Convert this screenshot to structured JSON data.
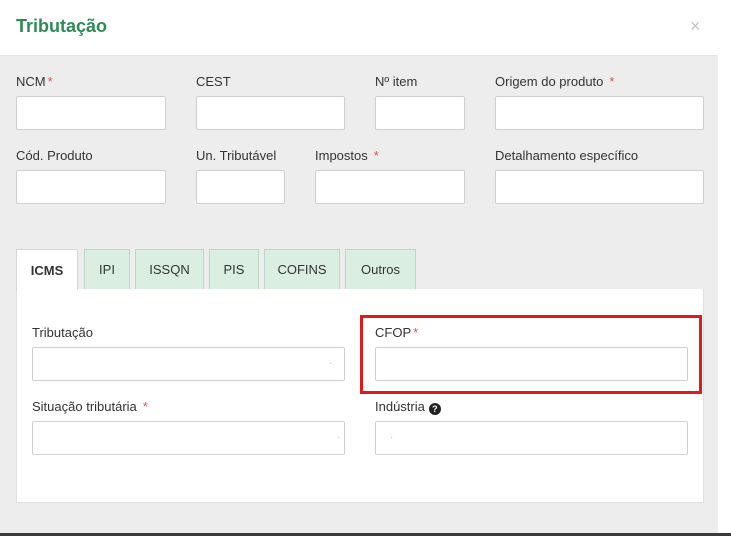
{
  "modal": {
    "title": "Tributação",
    "close_label": "×"
  },
  "fields": {
    "ncm": {
      "label": "NCM",
      "required": "*",
      "value": ""
    },
    "cest": {
      "label": "CEST",
      "value": ""
    },
    "n_item": {
      "label": "Nº item",
      "value": ""
    },
    "origem": {
      "label": "Origem do produto",
      "required": "*",
      "value": ""
    },
    "cod_produto": {
      "label": "Cód. Produto",
      "value": ""
    },
    "un_tributavel": {
      "label": "Un. Tributável",
      "value": ""
    },
    "impostos": {
      "label": "Impostos",
      "required": "*",
      "value": ""
    },
    "detalhamento": {
      "label": "Detalhamento específico",
      "value": ""
    }
  },
  "tabs": [
    {
      "label": "ICMS",
      "active": true
    },
    {
      "label": "IPI"
    },
    {
      "label": "ISSQN"
    },
    {
      "label": "PIS"
    },
    {
      "label": "COFINS"
    },
    {
      "label": "Outros"
    }
  ],
  "icms": {
    "tributacao": {
      "label": "Tributação",
      "value": ""
    },
    "cfop": {
      "label": "CFOP",
      "required": "*",
      "value": ""
    },
    "situacao": {
      "label": "Situação tributária",
      "required": "*",
      "value": ""
    },
    "industria": {
      "label": "Indústria",
      "help_icon": "question-circle-icon",
      "value": ""
    }
  },
  "highlight_color": "#e0191b",
  "accent_color": "#2e8b57"
}
